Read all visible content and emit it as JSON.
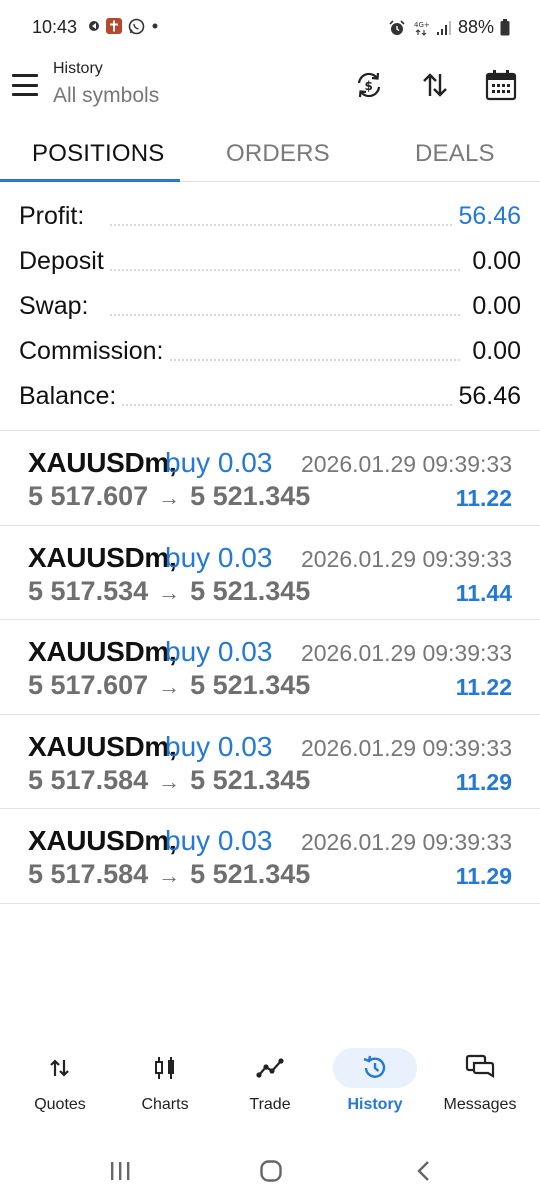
{
  "status_bar": {
    "time": "10:43",
    "network": "4G+",
    "battery": "88%"
  },
  "header": {
    "title": "History",
    "subtitle": "All symbols",
    "icons": [
      "currency-exchange-icon",
      "sort-icon",
      "calendar-icon"
    ]
  },
  "tabs": [
    {
      "label": "POSITIONS",
      "active": true
    },
    {
      "label": "ORDERS",
      "active": false
    },
    {
      "label": "DEALS",
      "active": false
    }
  ],
  "summary": {
    "profit_label": "Profit:",
    "profit_value": "56.46",
    "deposit_label": "Deposit",
    "deposit_value": "0.00",
    "swap_label": "Swap:",
    "swap_value": "0.00",
    "commission_label": "Commission:",
    "commission_value": "0.00",
    "balance_label": "Balance:",
    "balance_value": "56.46"
  },
  "deals": [
    {
      "symbol": "XAUUSDm,",
      "type": "buy 0.03",
      "time": "2026.01.29 09:39:33",
      "open_price": "5 517.607",
      "arrow": "→",
      "close_price": "5 521.345",
      "profit": "11.22"
    },
    {
      "symbol": "XAUUSDm,",
      "type": "buy 0.03",
      "time": "2026.01.29 09:39:33",
      "open_price": "5 517.534",
      "arrow": "→",
      "close_price": "5 521.345",
      "profit": "11.44"
    },
    {
      "symbol": "XAUUSDm,",
      "type": "buy 0.03",
      "time": "2026.01.29 09:39:33",
      "open_price": "5 517.607",
      "arrow": "→",
      "close_price": "5 521.345",
      "profit": "11.22"
    },
    {
      "symbol": "XAUUSDm,",
      "type": "buy 0.03",
      "time": "2026.01.29 09:39:33",
      "open_price": "5 517.584",
      "arrow": "→",
      "close_price": "5 521.345",
      "profit": "11.29"
    },
    {
      "symbol": "XAUUSDm,",
      "type": "buy 0.03",
      "time": "2026.01.29 09:39:33",
      "open_price": "5 517.584",
      "arrow": "→",
      "close_price": "5 521.345",
      "profit": "11.29"
    }
  ],
  "bottom_nav": [
    {
      "label": "Quotes",
      "icon": "quotes-arrows-icon",
      "active": false
    },
    {
      "label": "Charts",
      "icon": "candlestick-icon",
      "active": false
    },
    {
      "label": "Trade",
      "icon": "trend-line-icon",
      "active": false
    },
    {
      "label": "History",
      "icon": "history-clock-icon",
      "active": true
    },
    {
      "label": "Messages",
      "icon": "messages-icon",
      "active": false
    }
  ],
  "colors": {
    "accent": "#2478d6",
    "muted_text": "#777777",
    "divider": "#e2e2e2",
    "active_nav_bg": "#e8f1fc"
  }
}
